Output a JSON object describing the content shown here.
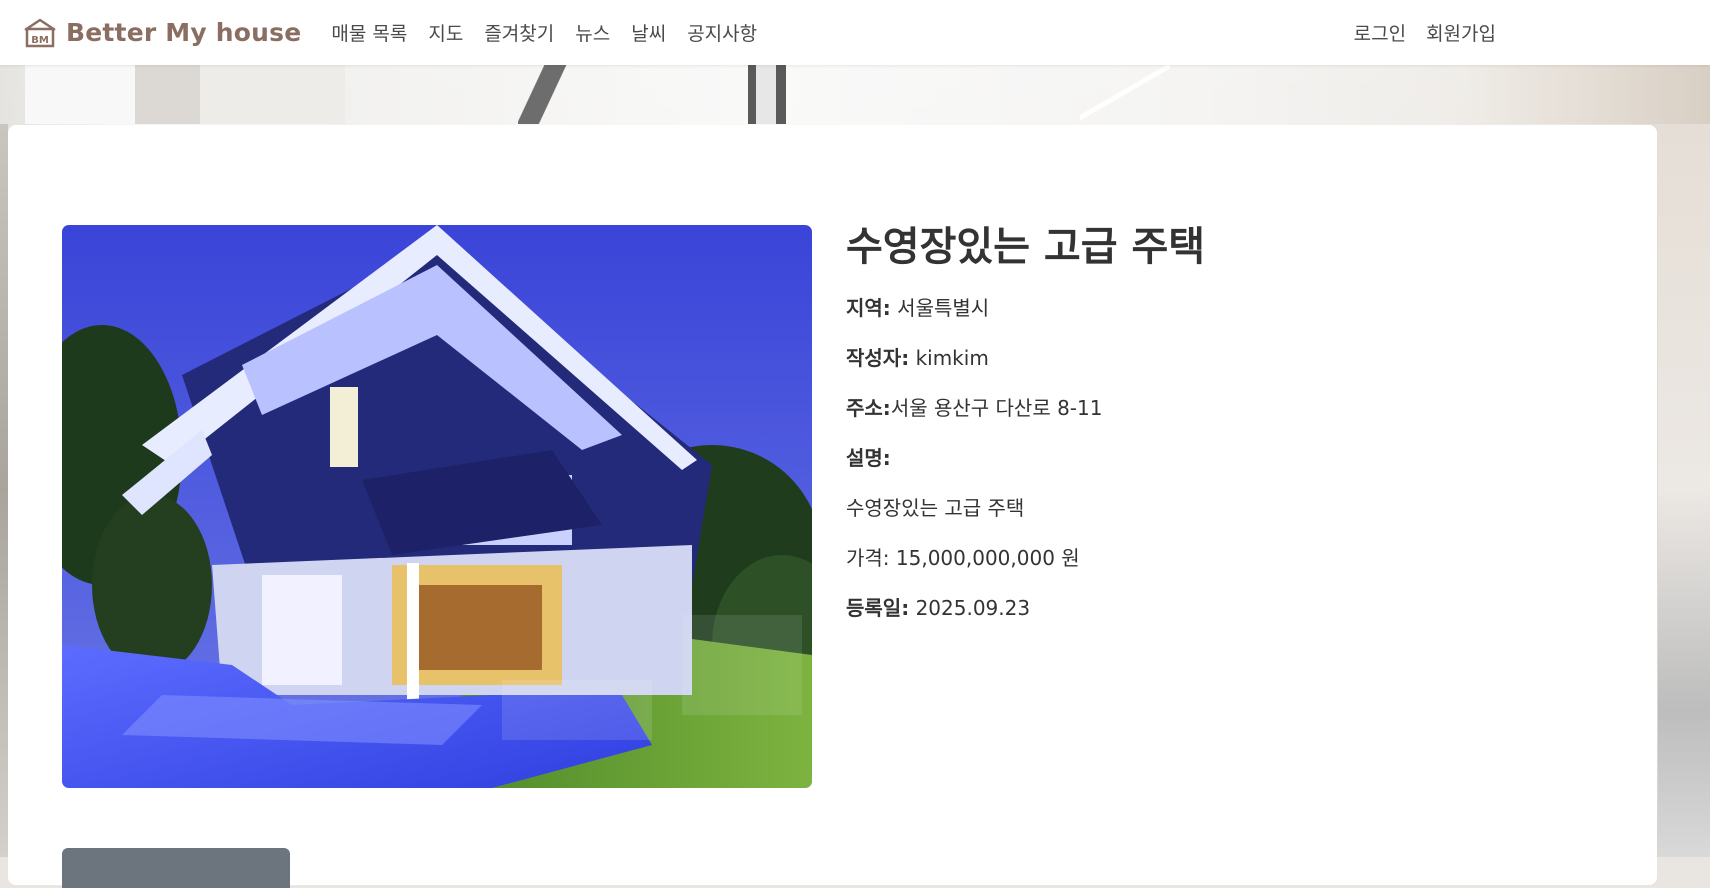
{
  "brand": {
    "name": "Better My house",
    "logo_text": "BM"
  },
  "nav": {
    "items": [
      "매물 목록",
      "지도",
      "즐겨찾기",
      "뉴스",
      "날씨",
      "공지사항"
    ],
    "right": [
      "로그인",
      "회원가입"
    ]
  },
  "listing": {
    "title": "수영장있는 고급 주택",
    "region_label": "지역:",
    "region": "서울특별시",
    "author_label": "작성자:",
    "author": "kimkim",
    "address_label": "주소:",
    "address": "서울 용산구 다산로 8-11",
    "description_label": "설명:",
    "description": "수영장있는 고급 주택",
    "price_text": "가격: 15,000,000,000 원",
    "date_label": "등록일:",
    "date": "2025.09.23"
  },
  "colors": {
    "brand": "#8b6e62",
    "button": "#6c757d"
  }
}
